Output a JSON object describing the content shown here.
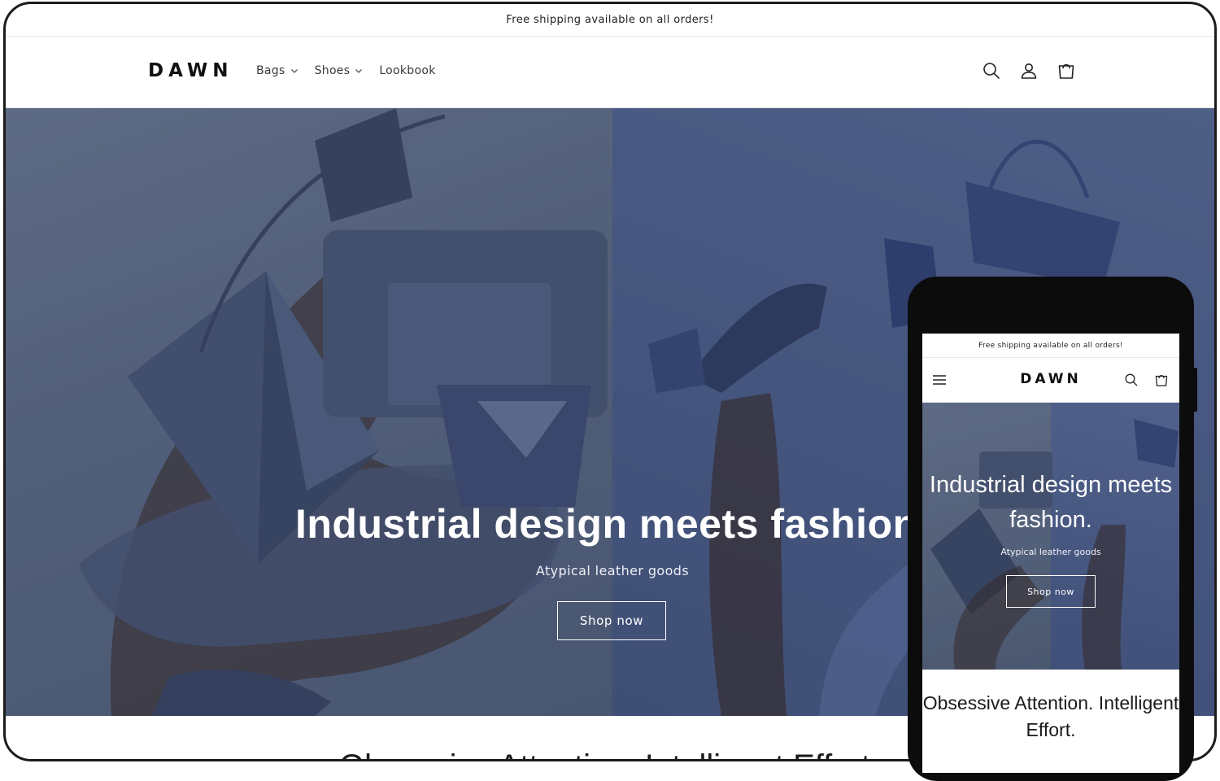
{
  "announcement": "Free shipping available on all orders!",
  "header": {
    "logo": "DAWN",
    "nav": [
      {
        "label": "Bags",
        "has_dropdown": true
      },
      {
        "label": "Shoes",
        "has_dropdown": true
      },
      {
        "label": "Lookbook",
        "has_dropdown": false
      }
    ],
    "icons": [
      "search-icon",
      "account-icon",
      "cart-icon"
    ]
  },
  "hero": {
    "title": "Industrial design meets fashion.",
    "subtitle": "Atypical leather goods",
    "button": "Shop now"
  },
  "next_section_title": "Obsessive Attention. Intelligent Effort.",
  "mobile": {
    "announcement": "Free shipping available on all orders!",
    "logo": "DAWN",
    "icons": [
      "menu-icon",
      "search-icon",
      "cart-icon"
    ],
    "hero": {
      "title": "Industrial design meets fashion.",
      "subtitle": "Atypical leather goods",
      "button": "Shop now"
    },
    "section_title": "Obsessive Attention. Intelligent Effort."
  },
  "colors": {
    "hero_left": "#5f6e8b",
    "hero_right": "#4f6290",
    "text_dark": "#121212",
    "phone_frame": "#0c0c0c"
  }
}
